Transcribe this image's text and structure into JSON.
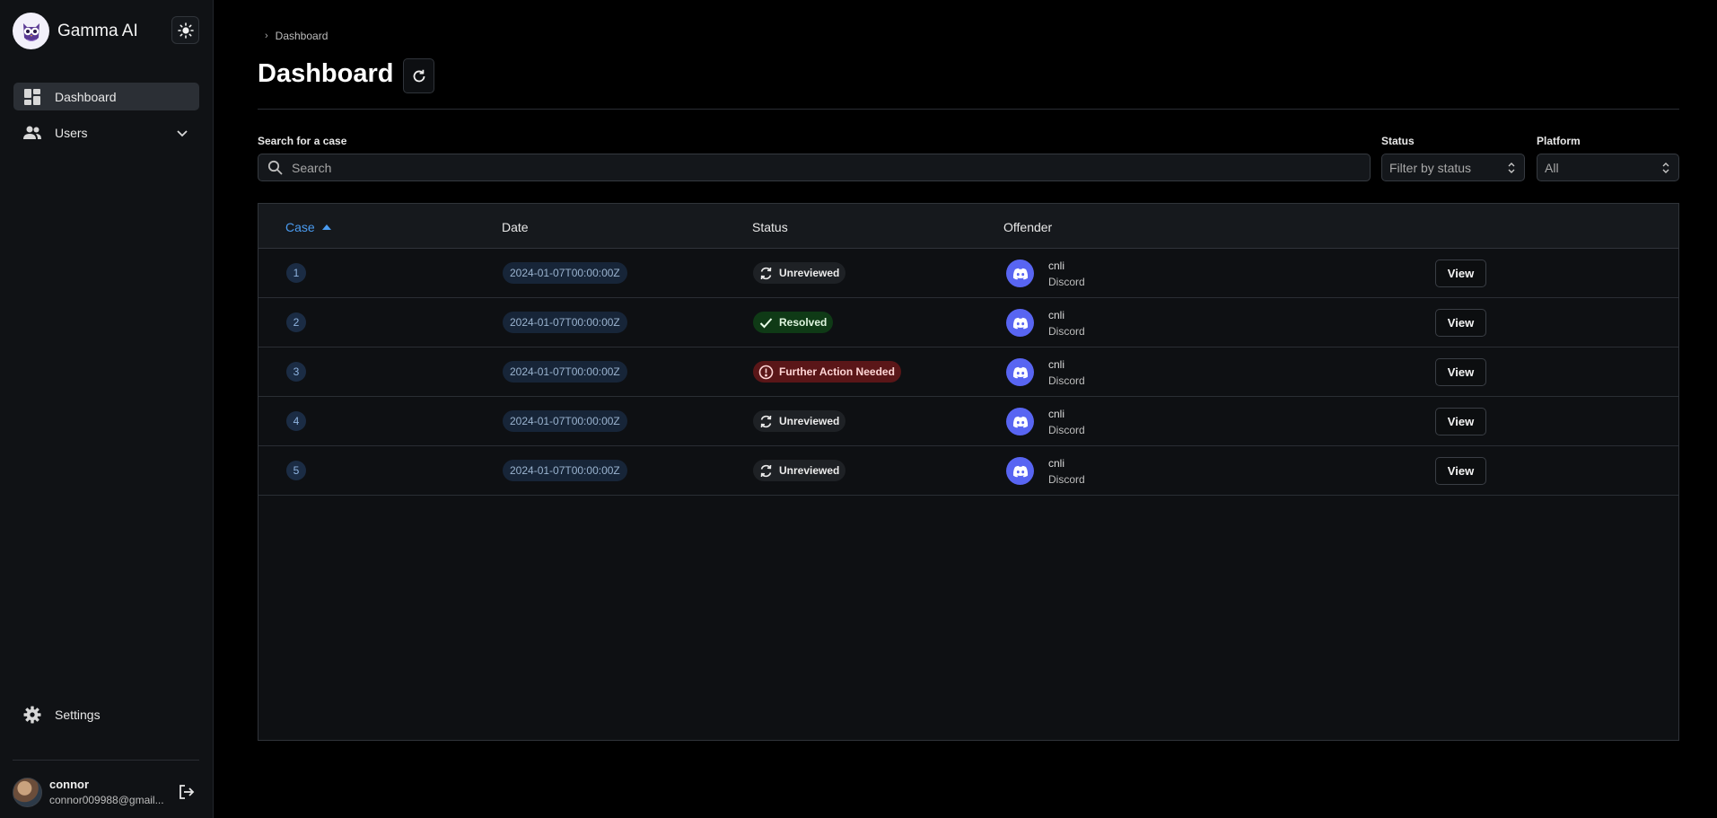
{
  "app": {
    "name": "Gamma AI"
  },
  "sidebar": {
    "items": [
      {
        "label": "Dashboard",
        "icon": "dashboard-icon",
        "active": true
      },
      {
        "label": "Users",
        "icon": "users-icon",
        "expandable": true
      }
    ],
    "settings_label": "Settings"
  },
  "user": {
    "name": "connor",
    "email": "connor009988@gmail..."
  },
  "breadcrumb": {
    "current": "Dashboard"
  },
  "page": {
    "title": "Dashboard"
  },
  "filters": {
    "search_label": "Search for a case",
    "search_placeholder": "Search",
    "status_label": "Status",
    "status_placeholder": "Filter by status",
    "platform_label": "Platform",
    "platform_value": "All"
  },
  "table": {
    "columns": {
      "case": "Case",
      "date": "Date",
      "status": "Status",
      "offender": "Offender"
    },
    "view_label": "View",
    "rows": [
      {
        "case": "1",
        "date": "2024-01-07T00:00:00Z",
        "status": "Unreviewed",
        "status_type": "unreviewed",
        "offender_name": "cnli",
        "offender_platform": "Discord"
      },
      {
        "case": "2",
        "date": "2024-01-07T00:00:00Z",
        "status": "Resolved",
        "status_type": "resolved",
        "offender_name": "cnli",
        "offender_platform": "Discord"
      },
      {
        "case": "3",
        "date": "2024-01-07T00:00:00Z",
        "status": "Further Action Needed",
        "status_type": "further",
        "offender_name": "cnli",
        "offender_platform": "Discord"
      },
      {
        "case": "4",
        "date": "2024-01-07T00:00:00Z",
        "status": "Unreviewed",
        "status_type": "unreviewed",
        "offender_name": "cnli",
        "offender_platform": "Discord"
      },
      {
        "case": "5",
        "date": "2024-01-07T00:00:00Z",
        "status": "Unreviewed",
        "status_type": "unreviewed",
        "offender_name": "cnli",
        "offender_platform": "Discord"
      }
    ]
  },
  "colors": {
    "accent": "#4a9bf0",
    "discord": "#5865f2",
    "resolved_bg": "#0f3a16",
    "further_bg": "#5a1618"
  }
}
